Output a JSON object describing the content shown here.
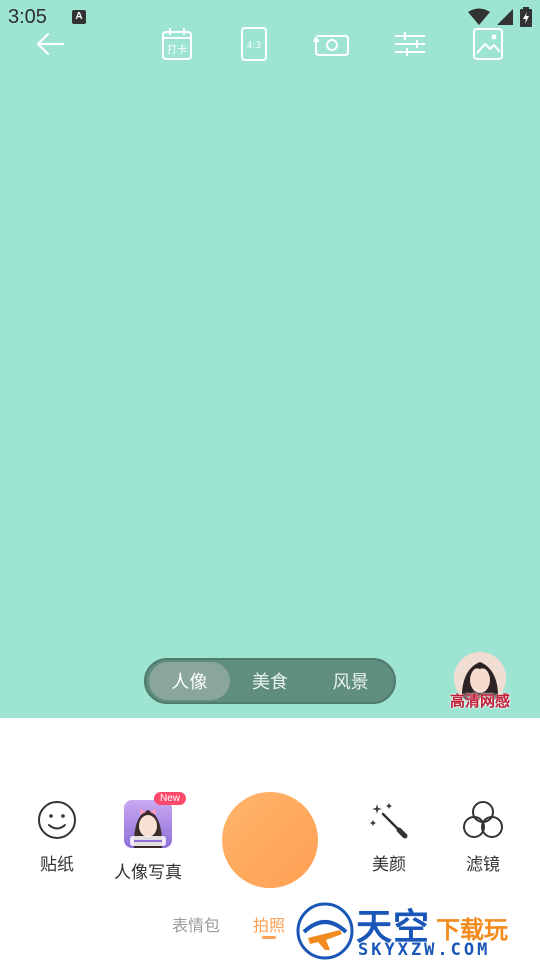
{
  "status_bar": {
    "time": "3:05",
    "a_badge": "A"
  },
  "top_toolbar": {
    "punch_label": "打卡",
    "ratio_label": "4:3"
  },
  "mode_switch": {
    "tabs": [
      {
        "label": "人像",
        "active": true
      },
      {
        "label": "美食",
        "active": false
      },
      {
        "label": "风景",
        "active": false
      }
    ]
  },
  "avatar": {
    "caption": "高清网感"
  },
  "tools": {
    "sticker": "贴纸",
    "portrait": "人像写真",
    "new_badge": "New",
    "beauty": "美颜",
    "filter": "滤镜"
  },
  "bottom_tabs": {
    "emoji": "表情包",
    "photo": "拍照"
  },
  "watermark": {
    "title_cn": "天空",
    "sub_cn": "下载玩",
    "domain": "SKYXZW.COM"
  },
  "colors": {
    "viewfinder": "#9ee4d2",
    "accent": "#ff9f52",
    "watermark_blue": "#1a56b8",
    "watermark_orange": "#f28a1e"
  }
}
